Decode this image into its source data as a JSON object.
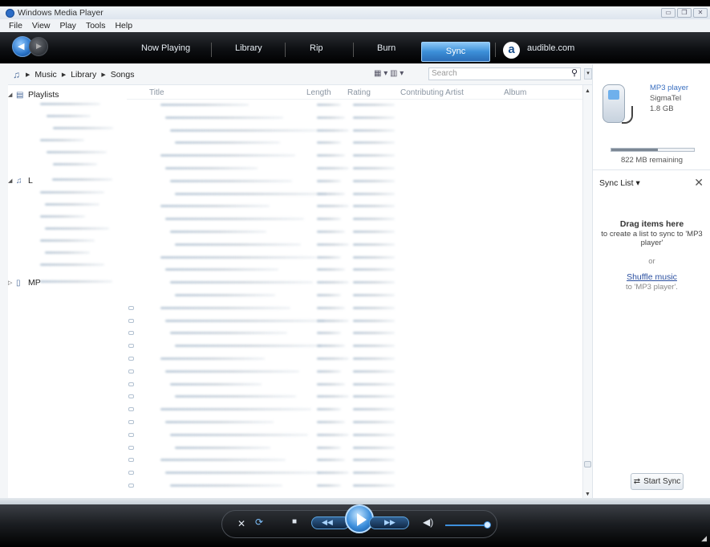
{
  "window": {
    "title": "Windows Media Player"
  },
  "menu": {
    "file": "File",
    "view": "View",
    "play": "Play",
    "tools": "Tools",
    "help": "Help"
  },
  "tabs": {
    "now_playing": "Now Playing",
    "library": "Library",
    "rip": "Rip",
    "burn": "Burn",
    "sync": "Sync",
    "audible": "audible.com"
  },
  "breadcrumb": {
    "music": "Music",
    "library": "Library",
    "songs": "Songs"
  },
  "search": {
    "placeholder": "Search"
  },
  "nav": {
    "playlists": "Playlists",
    "library_node": "L",
    "device_node": "MP"
  },
  "columns": {
    "title": "Title",
    "length": "Length",
    "rating": "Rating",
    "contributing_artist": "Contributing Artist",
    "album": "Album"
  },
  "device": {
    "name": "MP3 player",
    "manufacturer": "SigmaTel",
    "capacity": "1.8 GB",
    "remaining": "822 MB remaining",
    "used_fraction": 0.56
  },
  "sync_list": {
    "label": "Sync List",
    "drag_title": "Drag items here",
    "drag_text": "to create a list to sync to 'MP3 player'",
    "or": "or",
    "shuffle_link": "Shuffle music",
    "shuffle_text": "to 'MP3 player'.",
    "start_sync": "Start Sync"
  },
  "icons": {
    "back": "back-arrow-icon",
    "forward": "forward-arrow-icon",
    "music": "music-note-icon",
    "search": "search-icon",
    "shuffle": "shuffle-icon",
    "repeat": "repeat-icon",
    "stop": "stop-icon",
    "previous": "previous-icon",
    "play": "play-icon",
    "next": "next-icon",
    "mute": "speaker-icon",
    "close": "close-x-icon",
    "sync": "sync-icon"
  },
  "colors": {
    "accent": "#3d8fdc",
    "link": "#2a4fa0",
    "device_name": "#3a6fc0"
  }
}
